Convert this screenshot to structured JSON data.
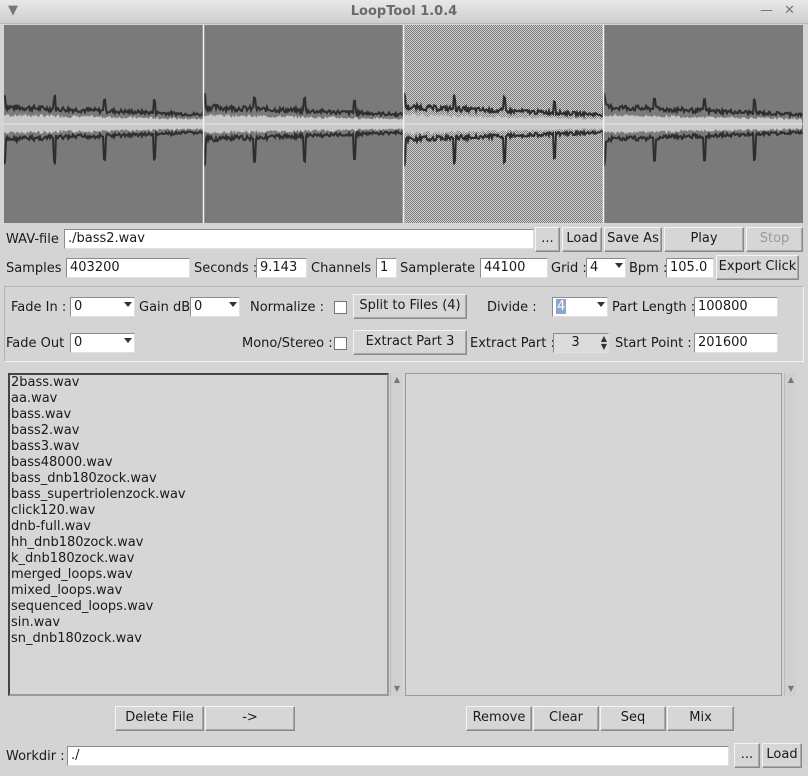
{
  "window": {
    "title": "LoopTool 1.0.4"
  },
  "file": {
    "label": "WAV-file :",
    "path": "./bass2.wav",
    "browse_label": "...",
    "load_label": "Load",
    "save_as_label": "Save As",
    "play_label": "Play",
    "stop_label": "Stop"
  },
  "info": {
    "samples_label": "Samples :",
    "samples": "403200",
    "seconds_label": "Seconds :",
    "seconds": "9.143",
    "channels_label": "Channels :",
    "channels": "1",
    "samplerate_label": "Samplerate :",
    "samplerate": "44100",
    "grid_label": "Grid :",
    "grid": "4",
    "bpm_label": "Bpm :",
    "bpm": "105.0",
    "export_click_label": "Export Click"
  },
  "process": {
    "fade_in_label": "Fade In :",
    "fade_in": "0",
    "gain_label": "Gain dB:",
    "gain": "0",
    "normalize_label": "Normalize :",
    "split_label": "Split to Files (4)",
    "divide_label": "Divide :",
    "divide": "4",
    "part_length_label": "Part Length :",
    "part_length": "100800",
    "fade_out_label": "Fade Out :",
    "fade_out": "0",
    "mono_stereo_label": "Mono/Stereo :",
    "extract_button_label": "Extract Part 3",
    "extract_part_label": "Extract Part :",
    "extract_part": "3",
    "start_point_label": "Start Point :",
    "start_point": "201600"
  },
  "files": [
    "2bass.wav",
    "aa.wav",
    "bass.wav",
    "bass2.wav",
    "bass3.wav",
    "bass48000.wav",
    "bass_dnb180zock.wav",
    "bass_supertriolenzock.wav",
    "click120.wav",
    "dnb-full.wav",
    "hh_dnb180zock.wav",
    "k_dnb180zock.wav",
    "merged_loops.wav",
    "mixed_loops.wav",
    "sequenced_loops.wav",
    "sin.wav",
    "sn_dnb180zock.wav"
  ],
  "buttons": {
    "delete_file": "Delete File",
    "add": "->",
    "remove": "Remove",
    "clear": "Clear",
    "seq": "Seq",
    "mix": "Mix"
  },
  "workdir": {
    "label": "Workdir :",
    "path": "./",
    "browse_label": "...",
    "load_label": "Load"
  },
  "colors": {
    "wave_bg": "#7a7a7a",
    "wave_dark": "#2e2e2e",
    "wave_light": "#c9c9c9",
    "selected_region": "#d0d0d0"
  }
}
